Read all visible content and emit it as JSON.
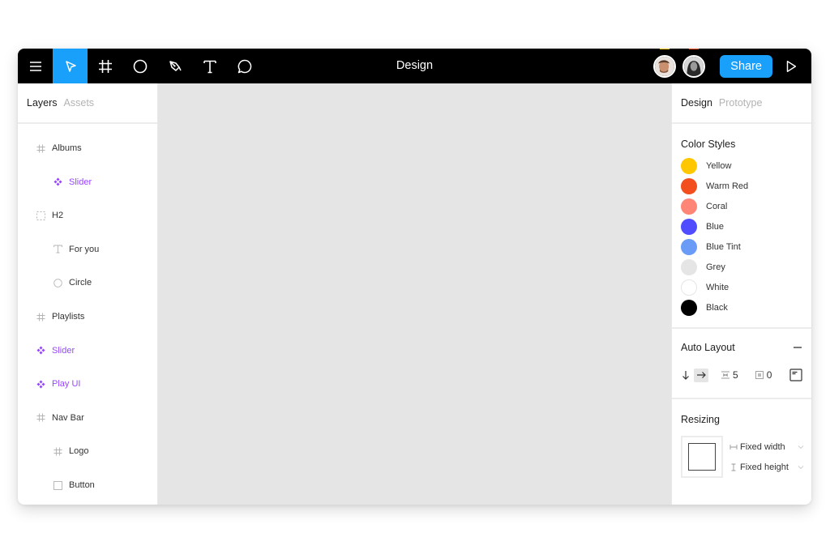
{
  "toolbar": {
    "title": "Design",
    "tools": [
      {
        "name": "menu",
        "icon": "hamburger-menu-icon",
        "active": false
      },
      {
        "name": "move",
        "icon": "cursor-arrow-icon",
        "active": true
      },
      {
        "name": "frame",
        "icon": "frame-hash-icon",
        "active": false
      },
      {
        "name": "ellipse",
        "icon": "ellipse-icon",
        "active": false
      },
      {
        "name": "pen",
        "icon": "pen-nib-icon",
        "active": false
      },
      {
        "name": "text",
        "icon": "text-t-icon",
        "active": false
      },
      {
        "name": "comment",
        "icon": "comment-bubble-icon",
        "active": false
      }
    ],
    "collaborators": [
      {
        "name": "collaborator-1",
        "presence_color": "#ffc700"
      },
      {
        "name": "collaborator-2",
        "presence_color": "#f24e1e"
      }
    ],
    "share_label": "Share",
    "play_icon": "play-triangle-icon",
    "active_color": "#18a0fb"
  },
  "left_panel": {
    "tabs": [
      {
        "label": "Layers",
        "active": true
      },
      {
        "label": "Assets",
        "active": false
      }
    ],
    "layers": [
      {
        "label": "Albums",
        "type": "frame",
        "depth": 0
      },
      {
        "label": "Slider",
        "type": "component",
        "depth": 1
      },
      {
        "label": "H2",
        "type": "group",
        "depth": 0
      },
      {
        "label": "For you",
        "type": "text",
        "depth": 1
      },
      {
        "label": "Circle",
        "type": "ellipse",
        "depth": 1
      },
      {
        "label": "Playlists",
        "type": "frame",
        "depth": 0
      },
      {
        "label": "Slider",
        "type": "component",
        "depth": 0
      },
      {
        "label": "Play UI",
        "type": "component",
        "depth": 0
      },
      {
        "label": "Nav Bar",
        "type": "frame",
        "depth": 0
      },
      {
        "label": "Logo",
        "type": "frame",
        "depth": 1
      },
      {
        "label": "Button",
        "type": "rectangle",
        "depth": 1
      }
    ],
    "component_color": "#9747ff"
  },
  "right_panel": {
    "tabs": [
      {
        "label": "Design",
        "active": true
      },
      {
        "label": "Prototype",
        "active": false
      }
    ],
    "color_styles": {
      "title": "Color Styles",
      "items": [
        {
          "label": "Yellow",
          "color": "#ffc700"
        },
        {
          "label": "Warm Red",
          "color": "#f24e1e"
        },
        {
          "label": "Coral",
          "color": "#ff8577"
        },
        {
          "label": "Blue",
          "color": "#4f4dff"
        },
        {
          "label": "Blue Tint",
          "color": "#699bf7"
        },
        {
          "label": "Grey",
          "color": "#e5e5e5"
        },
        {
          "label": "White",
          "color": "#ffffff"
        },
        {
          "label": "Black",
          "color": "#000000"
        }
      ]
    },
    "auto_layout": {
      "title": "Auto Layout",
      "direction_vertical_icon": "arrow-down-icon",
      "direction_horizontal_icon": "arrow-right-icon",
      "direction_selected": "horizontal",
      "spacing_value": "5",
      "padding_value": "0",
      "remove_icon": "minus-icon",
      "alignment_icon": "alignment-icon"
    },
    "resizing": {
      "title": "Resizing",
      "width_option": "Fixed width",
      "height_option": "Fixed height"
    }
  }
}
